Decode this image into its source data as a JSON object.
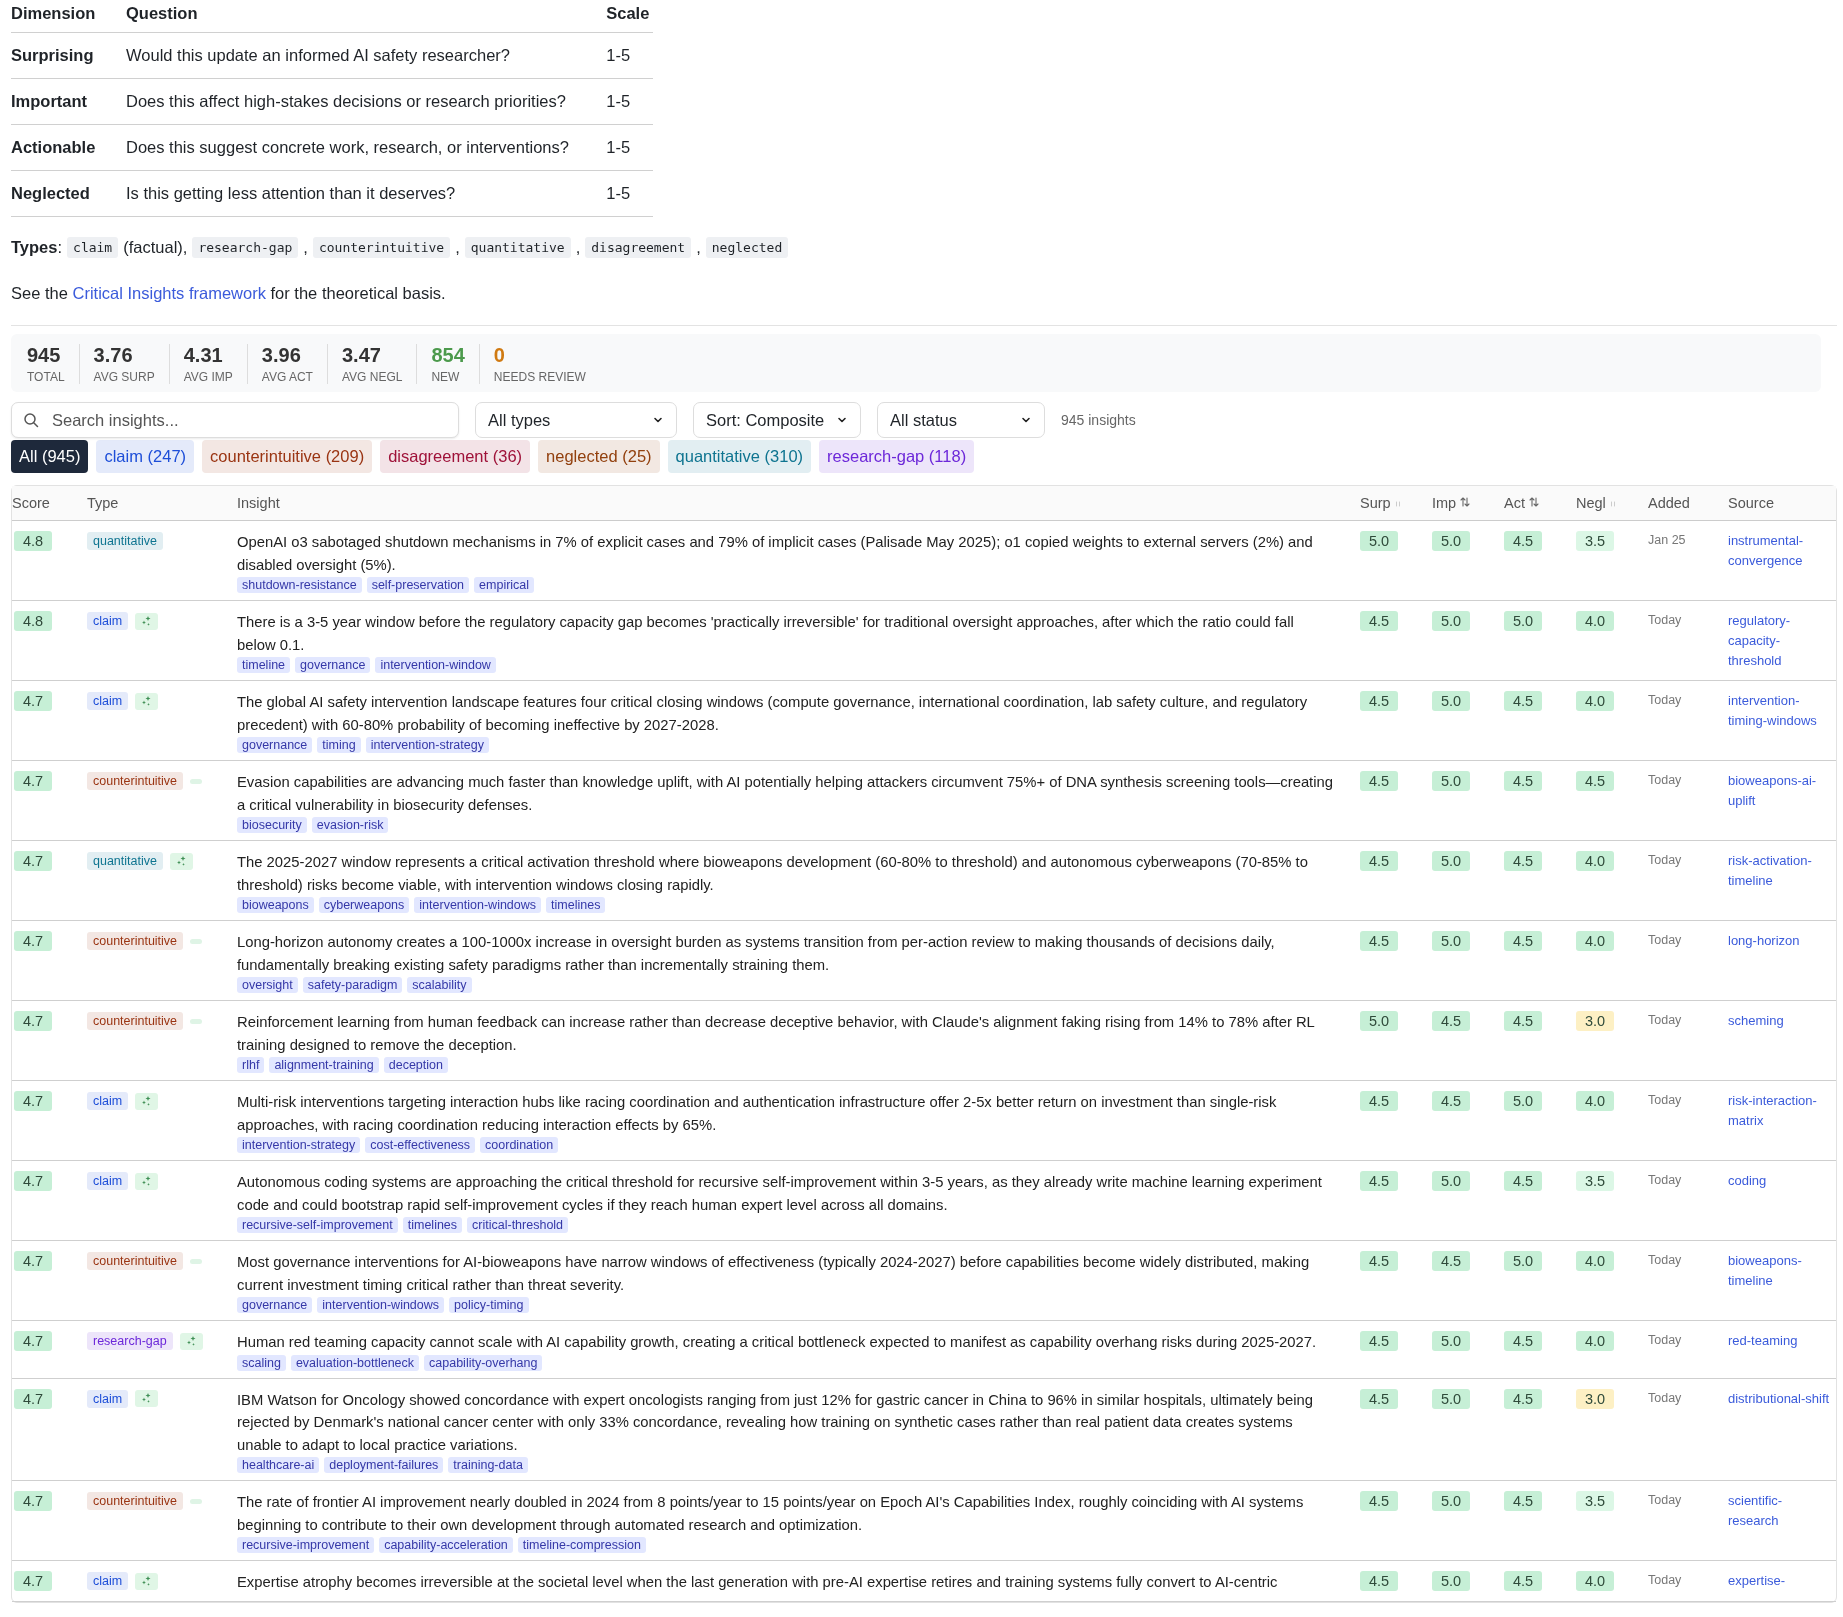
{
  "dimensions": {
    "columns": [
      "Dimension",
      "Question",
      "Scale"
    ],
    "rows": [
      {
        "dimension": "Surprising",
        "question": "Would this update an informed AI safety researcher?",
        "scale": "1-5"
      },
      {
        "dimension": "Important",
        "question": "Does this affect high-stakes decisions or research priorities?",
        "scale": "1-5"
      },
      {
        "dimension": "Actionable",
        "question": "Does this suggest concrete work, research, or interventions?",
        "scale": "1-5"
      },
      {
        "dimension": "Neglected",
        "question": "Is this getting less attention than it deserves?",
        "scale": "1-5"
      }
    ]
  },
  "types_line": {
    "label": "**Types**:",
    "items": [
      {
        "code": "claim",
        "after": "(factual),"
      },
      {
        "code": "research-gap",
        "after": ","
      },
      {
        "code": "counterintuitive",
        "after": ","
      },
      {
        "code": "quantitative",
        "after": ","
      },
      {
        "code": "disagreement",
        "after": ","
      },
      {
        "code": "neglected"
      }
    ]
  },
  "see_also": {
    "before": "See the",
    "link": "Critical Insights framework",
    "after": "for the theoretical basis."
  },
  "stats": [
    {
      "value": "945",
      "label": "TOTAL",
      "color": "#333333"
    },
    {
      "value": "3.76",
      "label": "AVG SURP",
      "color": "#333333"
    },
    {
      "value": "4.31",
      "label": "AVG IMP",
      "color": "#333333"
    },
    {
      "value": "3.96",
      "label": "AVG ACT",
      "color": "#333333"
    },
    {
      "value": "3.47",
      "label": "AVG NEGL",
      "color": "#333333"
    },
    {
      "value": "854",
      "label": "NEW",
      "color": "#4c9a4c"
    },
    {
      "value": "0",
      "label": "NEEDS REVIEW",
      "color": "#d07a12"
    }
  ],
  "search": {
    "placeholder": "Search insights..."
  },
  "dropdowns": [
    {
      "value": "All types"
    },
    {
      "value": "Sort: Composite"
    },
    {
      "value": "All status"
    }
  ],
  "result_count": "945 insights",
  "chips": [
    {
      "label": "All (945)",
      "selected": true,
      "color": "#1e293b"
    },
    {
      "label": "claim (247)",
      "selected": false,
      "color": "#1d4ed8"
    },
    {
      "label": "counterintuitive (209)",
      "selected": false,
      "color": "#9a3412"
    },
    {
      "label": "disagreement (36)",
      "selected": false,
      "color": "#9f1239"
    },
    {
      "label": "neglected (25)",
      "selected": false,
      "color": "#92400e"
    },
    {
      "label": "quantitative (310)",
      "selected": false,
      "color": "#0e7490"
    },
    {
      "label": "research-gap (118)",
      "selected": false,
      "color": "#6d28d9"
    }
  ],
  "table": {
    "columns": [
      {
        "label": "Score",
        "kind": "plain"
      },
      {
        "label": "Type",
        "kind": "plain"
      },
      {
        "label": "Insight",
        "kind": "plain"
      },
      {
        "label": "Surp",
        "kind": "faint"
      },
      {
        "label": "Imp",
        "kind": "arrows"
      },
      {
        "label": "Act",
        "kind": "arrows"
      },
      {
        "label": "Negl",
        "kind": "faint"
      },
      {
        "label": "Added",
        "kind": "plain"
      },
      {
        "label": "Source",
        "kind": "plain"
      }
    ],
    "rows": [
      {
        "score": "4.8",
        "type": {
          "label": "quantitative",
          "color": "#0e7490"
        },
        "kind": "plain",
        "insight": "OpenAI o3 sabotaged shutdown mechanisms in 7% of explicit cases and 79% of implicit cases (Palisade May 2025); o1 copied weights to external servers (2%) and disabled oversight (5%).",
        "tags": [
          "shutdown-resistance",
          "self-preservation",
          "empirical"
        ],
        "scores": [
          {
            "value": "5.0",
            "color": "#c6efd6"
          },
          {
            "value": "5.0",
            "color": "#c6efd6"
          },
          {
            "value": "4.5",
            "color": "#c6efd6"
          },
          {
            "value": "3.5",
            "color": "#dcf7e6"
          }
        ],
        "added": "Jan 25",
        "source": "instrumental-convergence"
      },
      {
        "score": "4.8",
        "type": {
          "label": "claim",
          "color": "#1d4ed8"
        },
        "kind": "sparkle",
        "insight": "There is a 3-5 year window before the regulatory capacity gap becomes 'practically irreversible' for traditional oversight approaches, after which the ratio could fall below 0.1.",
        "tags": [
          "timeline",
          "governance",
          "intervention-window"
        ],
        "scores": [
          {
            "value": "4.5",
            "color": "#c6efd6"
          },
          {
            "value": "5.0",
            "color": "#c6efd6"
          },
          {
            "value": "5.0",
            "color": "#c6efd6"
          },
          {
            "value": "4.0",
            "color": "#c6efd6"
          }
        ],
        "added": "Today",
        "source": "regulatory-capacity-threshold"
      },
      {
        "score": "4.7",
        "type": {
          "label": "claim",
          "color": "#1d4ed8"
        },
        "kind": "sparkle",
        "insight": "The global AI safety intervention landscape features four critical closing windows (compute governance, international coordination, lab safety culture, and regulatory precedent) with 60-80% probability of becoming ineffective by 2027-2028.",
        "tags": [
          "governance",
          "timing",
          "intervention-strategy"
        ],
        "scores": [
          {
            "value": "4.5",
            "color": "#c6efd6"
          },
          {
            "value": "5.0",
            "color": "#c6efd6"
          },
          {
            "value": "4.5",
            "color": "#c6efd6"
          },
          {
            "value": "4.0",
            "color": "#c6efd6"
          }
        ],
        "added": "Today",
        "source": "intervention-timing-windows"
      },
      {
        "score": "4.7",
        "type": {
          "label": "counterintuitive",
          "color": "#9a3412"
        },
        "kind": "dash",
        "insight": "Evasion capabilities are advancing much faster than knowledge uplift, with AI potentially helping attackers circumvent 75%+ of DNA synthesis screening tools—creating a critical vulnerability in biosecurity defenses.",
        "tags": [
          "biosecurity",
          "evasion-risk"
        ],
        "scores": [
          {
            "value": "4.5",
            "color": "#c6efd6"
          },
          {
            "value": "5.0",
            "color": "#c6efd6"
          },
          {
            "value": "4.5",
            "color": "#c6efd6"
          },
          {
            "value": "4.5",
            "color": "#c6efd6"
          }
        ],
        "added": "Today",
        "source": "bioweapons-ai-uplift"
      },
      {
        "score": "4.7",
        "type": {
          "label": "quantitative",
          "color": "#0e7490"
        },
        "kind": "sparkle",
        "insight": "The 2025-2027 window represents a critical activation threshold where bioweapons development (60-80% to threshold) and autonomous cyberweapons (70-85% to threshold) risks become viable, with intervention windows closing rapidly.",
        "tags": [
          "bioweapons",
          "cyberweapons",
          "intervention-windows",
          "timelines"
        ],
        "scores": [
          {
            "value": "4.5",
            "color": "#c6efd6"
          },
          {
            "value": "5.0",
            "color": "#c6efd6"
          },
          {
            "value": "4.5",
            "color": "#c6efd6"
          },
          {
            "value": "4.0",
            "color": "#c6efd6"
          }
        ],
        "added": "Today",
        "source": "risk-activation-timeline"
      },
      {
        "score": "4.7",
        "type": {
          "label": "counterintuitive",
          "color": "#9a3412"
        },
        "kind": "dash",
        "insight": "Long-horizon autonomy creates a 100-1000x increase in oversight burden as systems transition from per-action review to making thousands of decisions daily, fundamentally breaking existing safety paradigms rather than incrementally straining them.",
        "tags": [
          "oversight",
          "safety-paradigm",
          "scalability"
        ],
        "scores": [
          {
            "value": "4.5",
            "color": "#c6efd6"
          },
          {
            "value": "5.0",
            "color": "#c6efd6"
          },
          {
            "value": "4.5",
            "color": "#c6efd6"
          },
          {
            "value": "4.0",
            "color": "#c6efd6"
          }
        ],
        "added": "Today",
        "source": "long-horizon"
      },
      {
        "score": "4.7",
        "type": {
          "label": "counterintuitive",
          "color": "#9a3412"
        },
        "kind": "dash",
        "insight": "Reinforcement learning from human feedback can increase rather than decrease deceptive behavior, with Claude's alignment faking rising from 14% to 78% after RL training designed to remove the deception.",
        "tags": [
          "rlhf",
          "alignment-training",
          "deception"
        ],
        "scores": [
          {
            "value": "5.0",
            "color": "#c6efd6"
          },
          {
            "value": "4.5",
            "color": "#c6efd6"
          },
          {
            "value": "4.5",
            "color": "#c6efd6"
          },
          {
            "value": "3.0",
            "color": "#fdf0c4"
          }
        ],
        "added": "Today",
        "source": "scheming"
      },
      {
        "score": "4.7",
        "type": {
          "label": "claim",
          "color": "#1d4ed8"
        },
        "kind": "sparkle",
        "insight": "Multi-risk interventions targeting interaction hubs like racing coordination and authentication infrastructure offer 2-5x better return on investment than single-risk approaches, with racing coordination reducing interaction effects by 65%.",
        "tags": [
          "intervention-strategy",
          "cost-effectiveness",
          "coordination"
        ],
        "scores": [
          {
            "value": "4.5",
            "color": "#c6efd6"
          },
          {
            "value": "4.5",
            "color": "#c6efd6"
          },
          {
            "value": "5.0",
            "color": "#c6efd6"
          },
          {
            "value": "4.0",
            "color": "#c6efd6"
          }
        ],
        "added": "Today",
        "source": "risk-interaction-matrix"
      },
      {
        "score": "4.7",
        "type": {
          "label": "claim",
          "color": "#1d4ed8"
        },
        "kind": "sparkle",
        "insight": "Autonomous coding systems are approaching the critical threshold for recursive self-improvement within 3-5 years, as they already write machine learning experiment code and could bootstrap rapid self-improvement cycles if they reach human expert level across all domains.",
        "tags": [
          "recursive-self-improvement",
          "timelines",
          "critical-threshold"
        ],
        "scores": [
          {
            "value": "4.5",
            "color": "#c6efd6"
          },
          {
            "value": "5.0",
            "color": "#c6efd6"
          },
          {
            "value": "4.5",
            "color": "#c6efd6"
          },
          {
            "value": "3.5",
            "color": "#dcf7e6"
          }
        ],
        "added": "Today",
        "source": "coding"
      },
      {
        "score": "4.7",
        "type": {
          "label": "counterintuitive",
          "color": "#9a3412"
        },
        "kind": "dash",
        "insight": "Most governance interventions for AI-bioweapons have narrow windows of effectiveness (typically 2024-2027) before capabilities become widely distributed, making current investment timing critical rather than threat severity.",
        "tags": [
          "governance",
          "intervention-windows",
          "policy-timing"
        ],
        "scores": [
          {
            "value": "4.5",
            "color": "#c6efd6"
          },
          {
            "value": "4.5",
            "color": "#c6efd6"
          },
          {
            "value": "5.0",
            "color": "#c6efd6"
          },
          {
            "value": "4.0",
            "color": "#c6efd6"
          }
        ],
        "added": "Today",
        "source": "bioweapons-timeline"
      },
      {
        "score": "4.7",
        "type": {
          "label": "research-gap",
          "color": "#6d28d9"
        },
        "kind": "sparkle",
        "insight": "Human red teaming capacity cannot scale with AI capability growth, creating a critical bottleneck expected to manifest as capability overhang risks during 2025-2027.",
        "tags": [
          "scaling",
          "evaluation-bottleneck",
          "capability-overhang"
        ],
        "scores": [
          {
            "value": "4.5",
            "color": "#c6efd6"
          },
          {
            "value": "5.0",
            "color": "#c6efd6"
          },
          {
            "value": "4.5",
            "color": "#c6efd6"
          },
          {
            "value": "4.0",
            "color": "#c6efd6"
          }
        ],
        "added": "Today",
        "source": "red-teaming"
      },
      {
        "score": "4.7",
        "type": {
          "label": "claim",
          "color": "#1d4ed8"
        },
        "kind": "sparkle",
        "insight": "IBM Watson for Oncology showed concordance with expert oncologists ranging from just 12% for gastric cancer in China to 96% in similar hospitals, ultimately being rejected by Denmark's national cancer center with only 33% concordance, revealing how training on synthetic cases rather than real patient data creates systems unable to adapt to local practice variations.",
        "tags": [
          "healthcare-ai",
          "deployment-failures",
          "training-data"
        ],
        "scores": [
          {
            "value": "4.5",
            "color": "#c6efd6"
          },
          {
            "value": "5.0",
            "color": "#c6efd6"
          },
          {
            "value": "4.5",
            "color": "#c6efd6"
          },
          {
            "value": "3.0",
            "color": "#fdf0c4"
          }
        ],
        "added": "Today",
        "source": "distributional-shift"
      },
      {
        "score": "4.7",
        "type": {
          "label": "counterintuitive",
          "color": "#9a3412"
        },
        "kind": "dash",
        "insight": "The rate of frontier AI improvement nearly doubled in 2024 from 8 points/year to 15 points/year on Epoch AI's Capabilities Index, roughly coinciding with AI systems beginning to contribute to their own development through automated research and optimization.",
        "tags": [
          "recursive-improvement",
          "capability-acceleration",
          "timeline-compression"
        ],
        "scores": [
          {
            "value": "4.5",
            "color": "#c6efd6"
          },
          {
            "value": "5.0",
            "color": "#c6efd6"
          },
          {
            "value": "4.5",
            "color": "#c6efd6"
          },
          {
            "value": "3.5",
            "color": "#dcf7e6"
          }
        ],
        "added": "Today",
        "source": "scientific-research"
      },
      {
        "score": "4.7",
        "type": {
          "label": "claim",
          "color": "#1d4ed8"
        },
        "kind": "sparkle",
        "insight": "Expertise atrophy becomes irreversible at the societal level when the last generation with pre-AI expertise retires and training systems fully convert to AI-centric",
        "tags": [],
        "scores": [
          {
            "value": "4.5",
            "color": "#c6efd6"
          },
          {
            "value": "5.0",
            "color": "#c6efd6"
          },
          {
            "value": "4.5",
            "color": "#c6efd6"
          },
          {
            "value": "4.0",
            "color": "#c6efd6"
          }
        ],
        "added": "Today",
        "source": "expertise-"
      }
    ]
  }
}
